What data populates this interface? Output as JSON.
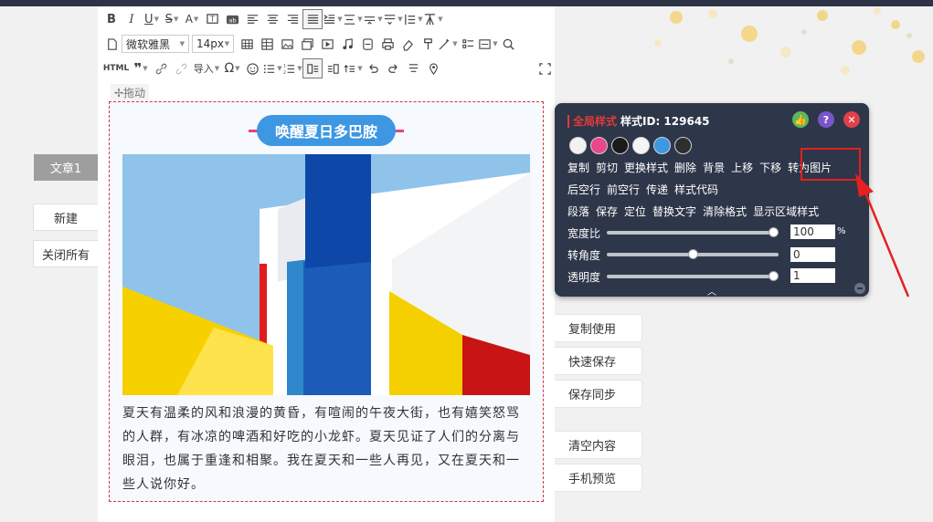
{
  "sidebar": {
    "article_tab": "文章1",
    "new_button": "新建",
    "close_all_button": "关闭所有"
  },
  "toolbar": {
    "font_family": "微软雅黑",
    "font_size": "14px",
    "html_label": "HTML",
    "import_label": "导入"
  },
  "editor": {
    "drag_label": "✢拖动",
    "title": "唤醒夏日多巴胺",
    "paragraph": "夏天有温柔的风和浪漫的黄昏，有喧闹的午夜大街，也有嬉笑怒骂的人群，有冰凉的啤酒和好吃的小龙虾。夏天见证了人们的分离与眼泪，也属于重逢和相聚。我在夏天和一些人再见，又在夏天和一些人说你好。"
  },
  "style_popup": {
    "global_style_label": "全局样式",
    "style_id_label": "样式ID: 129645",
    "swatches": [
      "#f2f2f2",
      "#e8478a",
      "#1b1b1b",
      "#f5f5f5",
      "#3d97e2",
      "#2e2e2e"
    ],
    "row1": [
      "复制",
      "剪切",
      "更换样式",
      "删除",
      "背景",
      "上移",
      "下移",
      "转为图片"
    ],
    "row2": [
      "后空行",
      "前空行",
      "传递",
      "样式代码"
    ],
    "row3": [
      "段落",
      "保存",
      "定位",
      "替换文字",
      "清除格式",
      "显示区域样式"
    ],
    "width_label": "宽度比",
    "width_value": "100",
    "width_unit": "%",
    "width_fraction": 1.0,
    "rotate_label": "转角度",
    "rotate_value": "0",
    "rotate_fraction": 0.5,
    "opacity_label": "透明度",
    "opacity_value": "1",
    "opacity_fraction": 1.0
  },
  "right_actions": {
    "copy_use": "复制使用",
    "quick_save": "快速保存",
    "save_sync": "保存同步",
    "clear_content": "清空内容",
    "mobile_preview": "手机预览"
  },
  "colors": {
    "accent_blue": "#3d97e2",
    "accent_pink": "#e2477f",
    "popup_bg": "#2e3649",
    "highlight_red": "#e52020"
  }
}
